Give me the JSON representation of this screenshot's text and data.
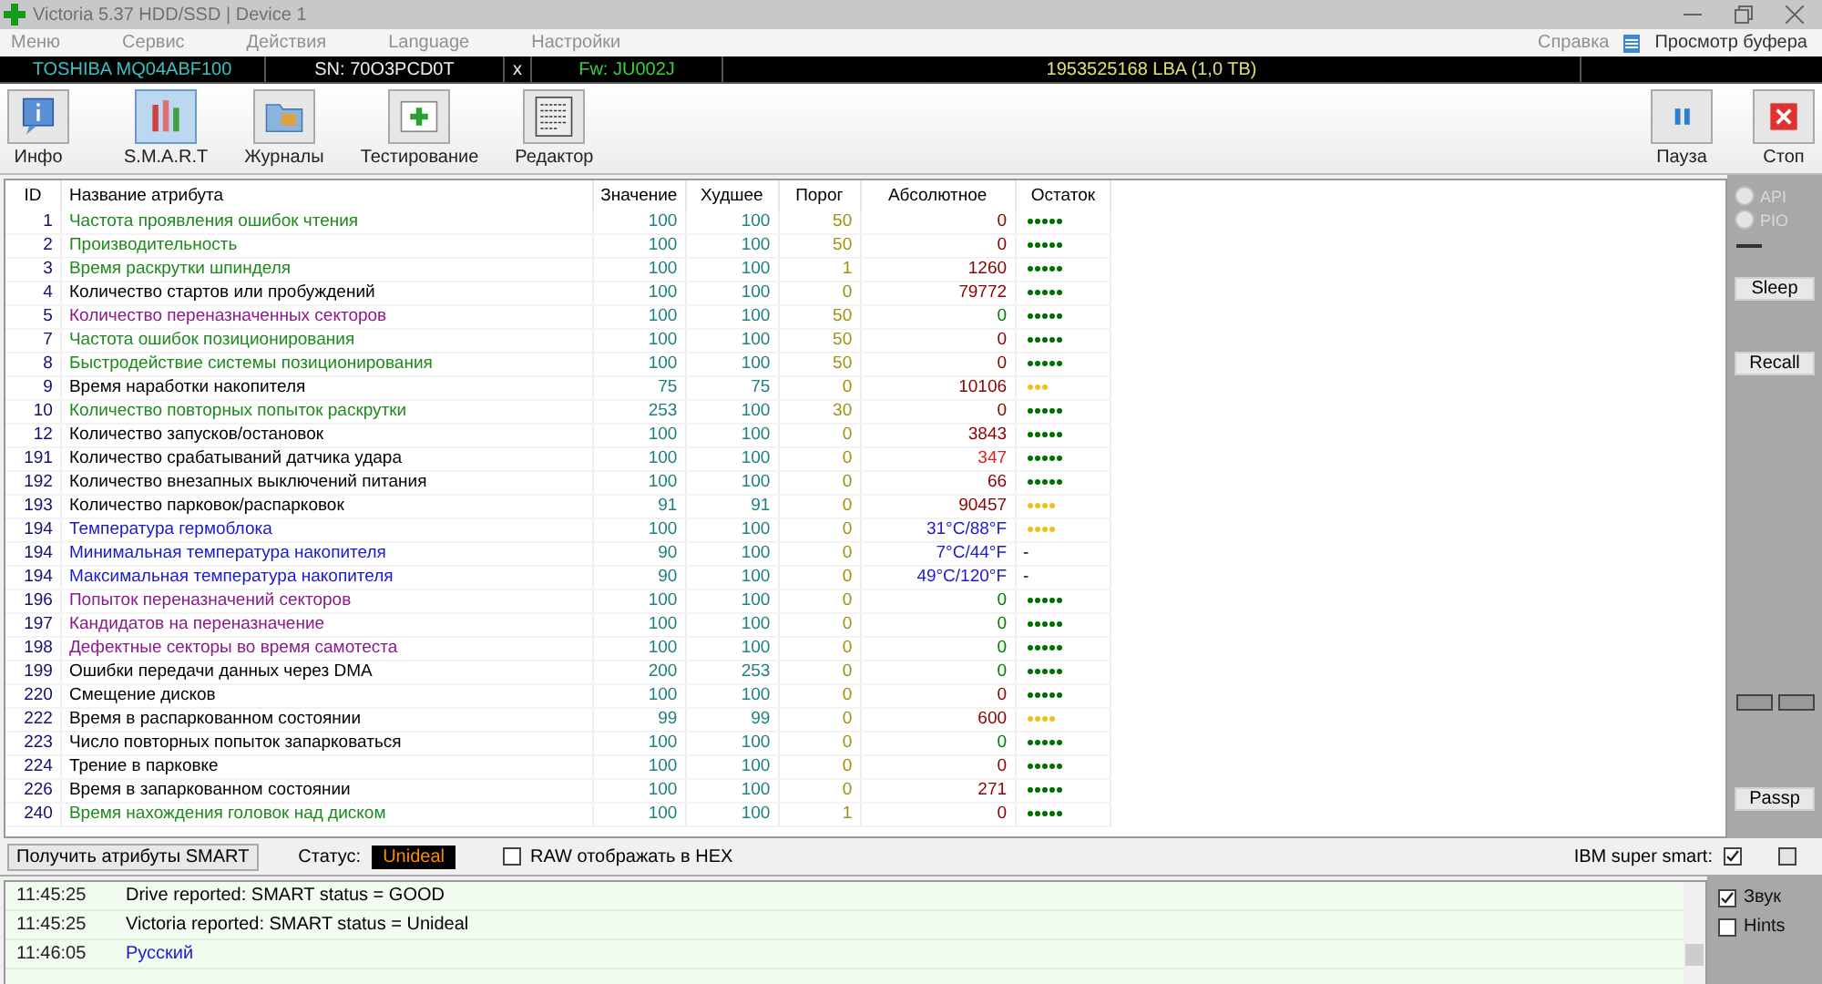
{
  "window": {
    "title": "Victoria 5.37 HDD/SSD | Device 1"
  },
  "menu": [
    {
      "label": "Меню"
    },
    {
      "label": "Сервис"
    },
    {
      "label": "Действия"
    },
    {
      "label": "Language"
    },
    {
      "label": "Настройки"
    }
  ],
  "menu_right": [
    {
      "label": "Справка"
    },
    {
      "label": "Просмотр буфера"
    }
  ],
  "device": {
    "model": "TOSHIBA MQ04ABF100",
    "serial": "SN: 70O3PCD0T",
    "close": "x",
    "firmware": "Fw: JU002J",
    "capacity": "1953525168 LBA (1,0 TB)"
  },
  "tabs": [
    {
      "label": "Инфо",
      "selected": false,
      "kind": "info"
    },
    {
      "label": "S.M.A.R.T",
      "selected": true,
      "kind": "smart"
    },
    {
      "label": "Журналы",
      "selected": false,
      "kind": "logs"
    },
    {
      "label": "Тестирование",
      "selected": false,
      "kind": "test"
    },
    {
      "label": "Редактор",
      "selected": false,
      "kind": "editor"
    }
  ],
  "actions": [
    {
      "label": "Пауза",
      "kind": "pause"
    },
    {
      "label": "Стоп",
      "kind": "stop"
    }
  ],
  "table": {
    "columns": [
      "ID",
      "Название атрибута",
      "Значение",
      "Худшее",
      "Порог",
      "Абсолютное",
      "Остаток"
    ],
    "rows": [
      {
        "id": "1",
        "name": "Частота проявления ошибок чтения",
        "color": "#1e8a1e",
        "value": "100",
        "worst": "100",
        "threshold": "50",
        "raw": {
          "text": "0",
          "color": "#8b0000"
        },
        "health": {
          "stars": 5,
          "color": "#007000"
        }
      },
      {
        "id": "2",
        "name": "Производительность",
        "color": "#1e8a1e",
        "value": "100",
        "worst": "100",
        "threshold": "50",
        "raw": {
          "text": "0",
          "color": "#8b0000"
        },
        "health": {
          "stars": 5,
          "color": "#007000"
        }
      },
      {
        "id": "3",
        "name": "Время раскрутки шпинделя",
        "color": "#1e8a1e",
        "value": "100",
        "worst": "100",
        "threshold": "1",
        "raw": {
          "text": "1260",
          "color": "#8b0000"
        },
        "health": {
          "stars": 5,
          "color": "#007000"
        }
      },
      {
        "id": "4",
        "name": "Количество стартов или пробуждений",
        "color": "#000000",
        "value": "100",
        "worst": "100",
        "threshold": "0",
        "raw": {
          "text": "79772",
          "color": "#8b0000"
        },
        "health": {
          "stars": 5,
          "color": "#007000"
        }
      },
      {
        "id": "5",
        "name": "Количество переназначенных секторов",
        "color": "#8b1a8b",
        "value": "100",
        "worst": "100",
        "threshold": "50",
        "raw": {
          "text": "0",
          "color": "#008000"
        },
        "health": {
          "stars": 5,
          "color": "#007000"
        }
      },
      {
        "id": "7",
        "name": "Частота ошибок позиционирования",
        "color": "#1e8a1e",
        "value": "100",
        "worst": "100",
        "threshold": "50",
        "raw": {
          "text": "0",
          "color": "#8b0000"
        },
        "health": {
          "stars": 5,
          "color": "#007000"
        }
      },
      {
        "id": "8",
        "name": "Быстродействие системы позиционирования",
        "color": "#1e8a1e",
        "value": "100",
        "worst": "100",
        "threshold": "50",
        "raw": {
          "text": "0",
          "color": "#8b0000"
        },
        "health": {
          "stars": 5,
          "color": "#007000"
        }
      },
      {
        "id": "9",
        "name": "Время наработки накопителя",
        "color": "#000000",
        "value": "75",
        "worst": "75",
        "threshold": "0",
        "raw": {
          "text": "10106",
          "color": "#8b0000"
        },
        "health": {
          "stars": 3,
          "color": "#f0c020"
        }
      },
      {
        "id": "10",
        "name": "Количество повторных попыток раскрутки",
        "color": "#1e8a1e",
        "value": "253",
        "worst": "100",
        "threshold": "30",
        "raw": {
          "text": "0",
          "color": "#8b0000"
        },
        "health": {
          "stars": 5,
          "color": "#007000"
        }
      },
      {
        "id": "12",
        "name": "Количество запусков/остановок",
        "color": "#000000",
        "value": "100",
        "worst": "100",
        "threshold": "0",
        "raw": {
          "text": "3843",
          "color": "#8b0000"
        },
        "health": {
          "stars": 5,
          "color": "#007000"
        }
      },
      {
        "id": "191",
        "name": "Количество срабатываний датчика удара",
        "color": "#000000",
        "value": "100",
        "worst": "100",
        "threshold": "0",
        "raw": {
          "text": "347",
          "color": "#e02020"
        },
        "health": {
          "stars": 5,
          "color": "#007000"
        }
      },
      {
        "id": "192",
        "name": "Количество внезапных выключений питания",
        "color": "#000000",
        "value": "100",
        "worst": "100",
        "threshold": "0",
        "raw": {
          "text": "66",
          "color": "#8b0000"
        },
        "health": {
          "stars": 5,
          "color": "#007000"
        }
      },
      {
        "id": "193",
        "name": "Количество парковок/распарковок",
        "color": "#000000",
        "value": "91",
        "worst": "91",
        "threshold": "0",
        "raw": {
          "text": "90457",
          "color": "#8b0000"
        },
        "health": {
          "stars": 4,
          "color": "#f0c020"
        }
      },
      {
        "id": "194",
        "name": "Температура гермоблока",
        "color": "#1a1acc",
        "value": "100",
        "worst": "100",
        "threshold": "0",
        "raw": {
          "text": "31°C/88°F",
          "color": "#1a1acc"
        },
        "health": {
          "stars": 4,
          "color": "#f0c020"
        }
      },
      {
        "id": "194",
        "name": "Минимальная температура накопителя",
        "color": "#1a1acc",
        "value": "90",
        "worst": "100",
        "threshold": "0",
        "raw": {
          "text": "7°C/44°F",
          "color": "#1a1acc"
        },
        "remaining": "-"
      },
      {
        "id": "194",
        "name": "Максимальная температура накопителя",
        "color": "#1a1acc",
        "value": "90",
        "worst": "100",
        "threshold": "0",
        "raw": {
          "text": "49°C/120°F",
          "color": "#1a1acc"
        },
        "remaining": "-"
      },
      {
        "id": "196",
        "name": "Попыток переназначений секторов",
        "color": "#8b1a8b",
        "value": "100",
        "worst": "100",
        "threshold": "0",
        "raw": {
          "text": "0",
          "color": "#008000"
        },
        "health": {
          "stars": 5,
          "color": "#007000"
        }
      },
      {
        "id": "197",
        "name": "Кандидатов на переназначение",
        "color": "#8b1a8b",
        "value": "100",
        "worst": "100",
        "threshold": "0",
        "raw": {
          "text": "0",
          "color": "#008000"
        },
        "health": {
          "stars": 5,
          "color": "#007000"
        }
      },
      {
        "id": "198",
        "name": "Дефектные секторы во время самотеста",
        "color": "#8b1a8b",
        "value": "100",
        "worst": "100",
        "threshold": "0",
        "raw": {
          "text": "0",
          "color": "#008000"
        },
        "health": {
          "stars": 5,
          "color": "#007000"
        }
      },
      {
        "id": "199",
        "name": "Ошибки передачи данных через DMA",
        "color": "#000000",
        "value": "200",
        "worst": "253",
        "threshold": "0",
        "raw": {
          "text": "0",
          "color": "#008000"
        },
        "health": {
          "stars": 5,
          "color": "#007000"
        }
      },
      {
        "id": "220",
        "name": "Смещение дисков",
        "color": "#000000",
        "value": "100",
        "worst": "100",
        "threshold": "0",
        "raw": {
          "text": "0",
          "color": "#8b0000"
        },
        "health": {
          "stars": 5,
          "color": "#007000"
        }
      },
      {
        "id": "222",
        "name": "Время в распаркованном состоянии",
        "color": "#000000",
        "value": "99",
        "worst": "99",
        "threshold": "0",
        "raw": {
          "text": "600",
          "color": "#8b0000"
        },
        "health": {
          "stars": 4,
          "color": "#f0c020"
        }
      },
      {
        "id": "223",
        "name": "Число повторных попыток запарковаться",
        "color": "#000000",
        "value": "100",
        "worst": "100",
        "threshold": "0",
        "raw": {
          "text": "0",
          "color": "#008000"
        },
        "health": {
          "stars": 5,
          "color": "#007000"
        }
      },
      {
        "id": "224",
        "name": "Трение в парковке",
        "color": "#000000",
        "value": "100",
        "worst": "100",
        "threshold": "0",
        "raw": {
          "text": "0",
          "color": "#8b0000"
        },
        "health": {
          "stars": 5,
          "color": "#007000"
        }
      },
      {
        "id": "226",
        "name": "Время в запаркованном состоянии",
        "color": "#000000",
        "value": "100",
        "worst": "100",
        "threshold": "0",
        "raw": {
          "text": "271",
          "color": "#8b0000"
        },
        "health": {
          "stars": 5,
          "color": "#007000"
        }
      },
      {
        "id": "240",
        "name": "Время нахождения головок над диском",
        "color": "#1e8a1e",
        "value": "100",
        "worst": "100",
        "threshold": "1",
        "raw": {
          "text": "0",
          "color": "#8b0000"
        },
        "health": {
          "stars": 5,
          "color": "#007000"
        }
      }
    ]
  },
  "side": {
    "radios": [
      {
        "label": "API",
        "selected": false
      },
      {
        "label": "PIO",
        "selected": false
      }
    ],
    "buttons": [
      {
        "label": "Sleep"
      },
      {
        "label": "Recall"
      },
      {
        "label": "Passp"
      }
    ]
  },
  "status_bar": {
    "button": "Получить атрибуты SMART",
    "status_label": "Статус:",
    "status": "Unideal",
    "raw_hex": {
      "label": "RAW отображать в HEX",
      "checked": false
    },
    "ibm": {
      "label": "IBM super smart:",
      "checked": true
    },
    "extra": {
      "checked": false
    }
  },
  "log": [
    {
      "time": "11:45:25",
      "message": "Drive reported: SMART status = GOOD",
      "color": "#000000"
    },
    {
      "time": "11:45:25",
      "message": "Victoria reported: SMART status = Unideal",
      "color": "#000000"
    },
    {
      "time": "11:46:05",
      "message": "Русский",
      "color": "#1a1acc"
    }
  ],
  "options": [
    {
      "label": "Звук",
      "checked": true
    },
    {
      "label": "Hints",
      "checked": false
    }
  ]
}
